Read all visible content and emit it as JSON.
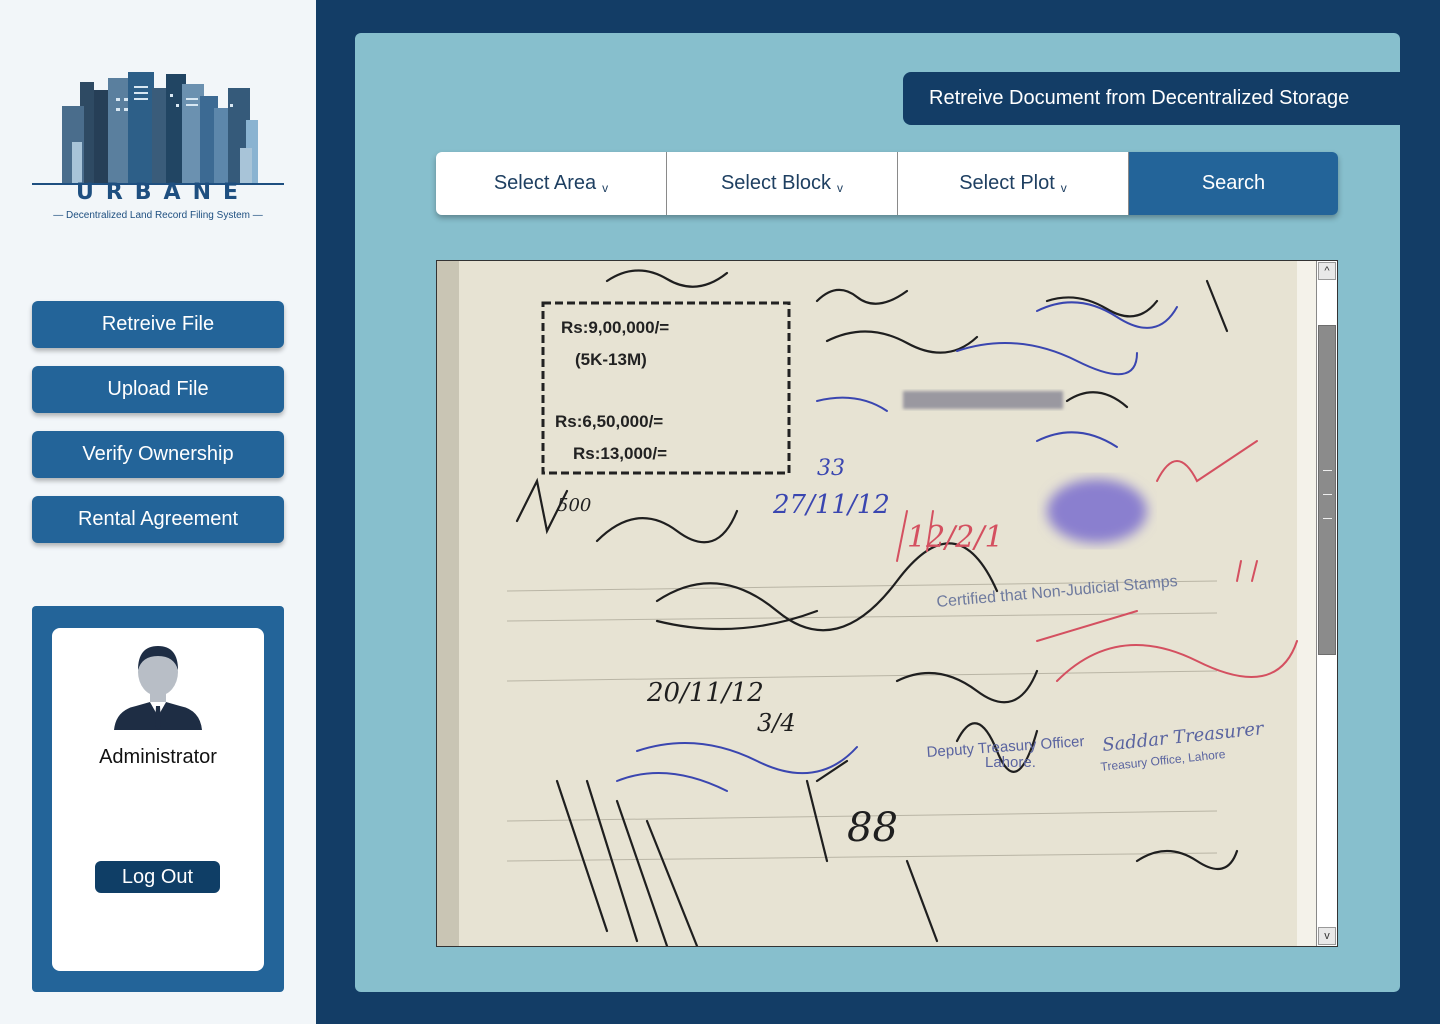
{
  "brand": {
    "name": "URBANE",
    "tagline": "— Decentralized Land Record Filing System —"
  },
  "nav": {
    "items": [
      {
        "label": "Retreive File"
      },
      {
        "label": "Upload File"
      },
      {
        "label": "Verify Ownership"
      },
      {
        "label": "Rental Agreement"
      }
    ]
  },
  "user": {
    "role": "Administrator",
    "logout_label": "Log Out"
  },
  "header": {
    "title": "Retreive Document from Decentralized Storage"
  },
  "filters": {
    "area_label": "Select Area",
    "block_label": "Select Block",
    "plot_label": "Select Plot",
    "chevron": "v",
    "search_label": "Search"
  },
  "document": {
    "stamp_lines": [
      "Rs:9,00,000/=",
      "(5K-13M)",
      "Rs:6,50,000/=",
      "Rs:13,000/="
    ],
    "handwritten_numbers": [
      "33",
      "27/11/12",
      "12/2/1",
      "20/11/12",
      "3/4",
      "88",
      "500"
    ],
    "treasury_text": [
      "Deputy Treasury Officer",
      "Lahore.",
      "Saddar Treasurer",
      "Treasury Office, Lahore"
    ],
    "certified_text": "Certified that Non-Judicial Stamps",
    "icons": [
      "chevron-up-icon",
      "chevron-down-icon"
    ]
  },
  "colors": {
    "navy": "#133d66",
    "accent_blue": "#236499",
    "panel_teal": "#87bfcd",
    "sidebar_bg": "#f2f6f9"
  }
}
